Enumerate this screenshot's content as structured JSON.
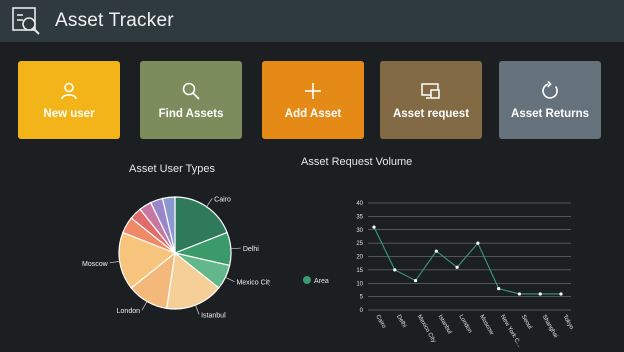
{
  "app": {
    "title": "Asset Tracker",
    "icon": "asset-tracker-icon"
  },
  "tiles": [
    {
      "label": "New user",
      "icon": "user-icon",
      "color": "#f2b418"
    },
    {
      "label": "Find Assets",
      "icon": "search-icon",
      "color": "#7c8c5c"
    },
    {
      "label": "Add Asset",
      "icon": "plus-icon",
      "color": "#e58a16"
    },
    {
      "label": "Asset request",
      "icon": "monitor-icon",
      "color": "#826a45"
    },
    {
      "label": "Asset Returns",
      "icon": "refresh-icon",
      "color": "#65727c"
    }
  ],
  "chart_data": [
    {
      "type": "pie",
      "title": "Asset User Types",
      "categories": [
        "Cairo",
        "Delhi",
        "Mexico City",
        "Istanbul",
        "London",
        "Moscow",
        "",
        "",
        "",
        "",
        ""
      ],
      "values": [
        16,
        8,
        6,
        14,
        10,
        14,
        4,
        3,
        3,
        3,
        3
      ],
      "colors": [
        "#2e7a5a",
        "#3a9a6a",
        "#62b88a",
        "#f6cf98",
        "#f4b97a",
        "#f7c47e",
        "#ef8a68",
        "#e26b6b",
        "#c777a0",
        "#9a86c8",
        "#8a9ad0"
      ]
    },
    {
      "type": "line",
      "title": "Asset Request Volume",
      "legend": "Area",
      "legend_color": "#3b9a72",
      "categories": [
        "Cairo",
        "Delhi",
        "Mexico City",
        "Istanbul",
        "London",
        "Moscow",
        "New York C...",
        "Seoul",
        "Shanghai",
        "Tokyo"
      ],
      "values": [
        31,
        15,
        11,
        22,
        16,
        25,
        8,
        6,
        6,
        6
      ],
      "ylim": [
        0,
        40
      ],
      "yticks": [
        "0",
        "5",
        "10",
        "15",
        "20",
        "25",
        "30",
        "35",
        "40"
      ],
      "grid": true
    }
  ]
}
